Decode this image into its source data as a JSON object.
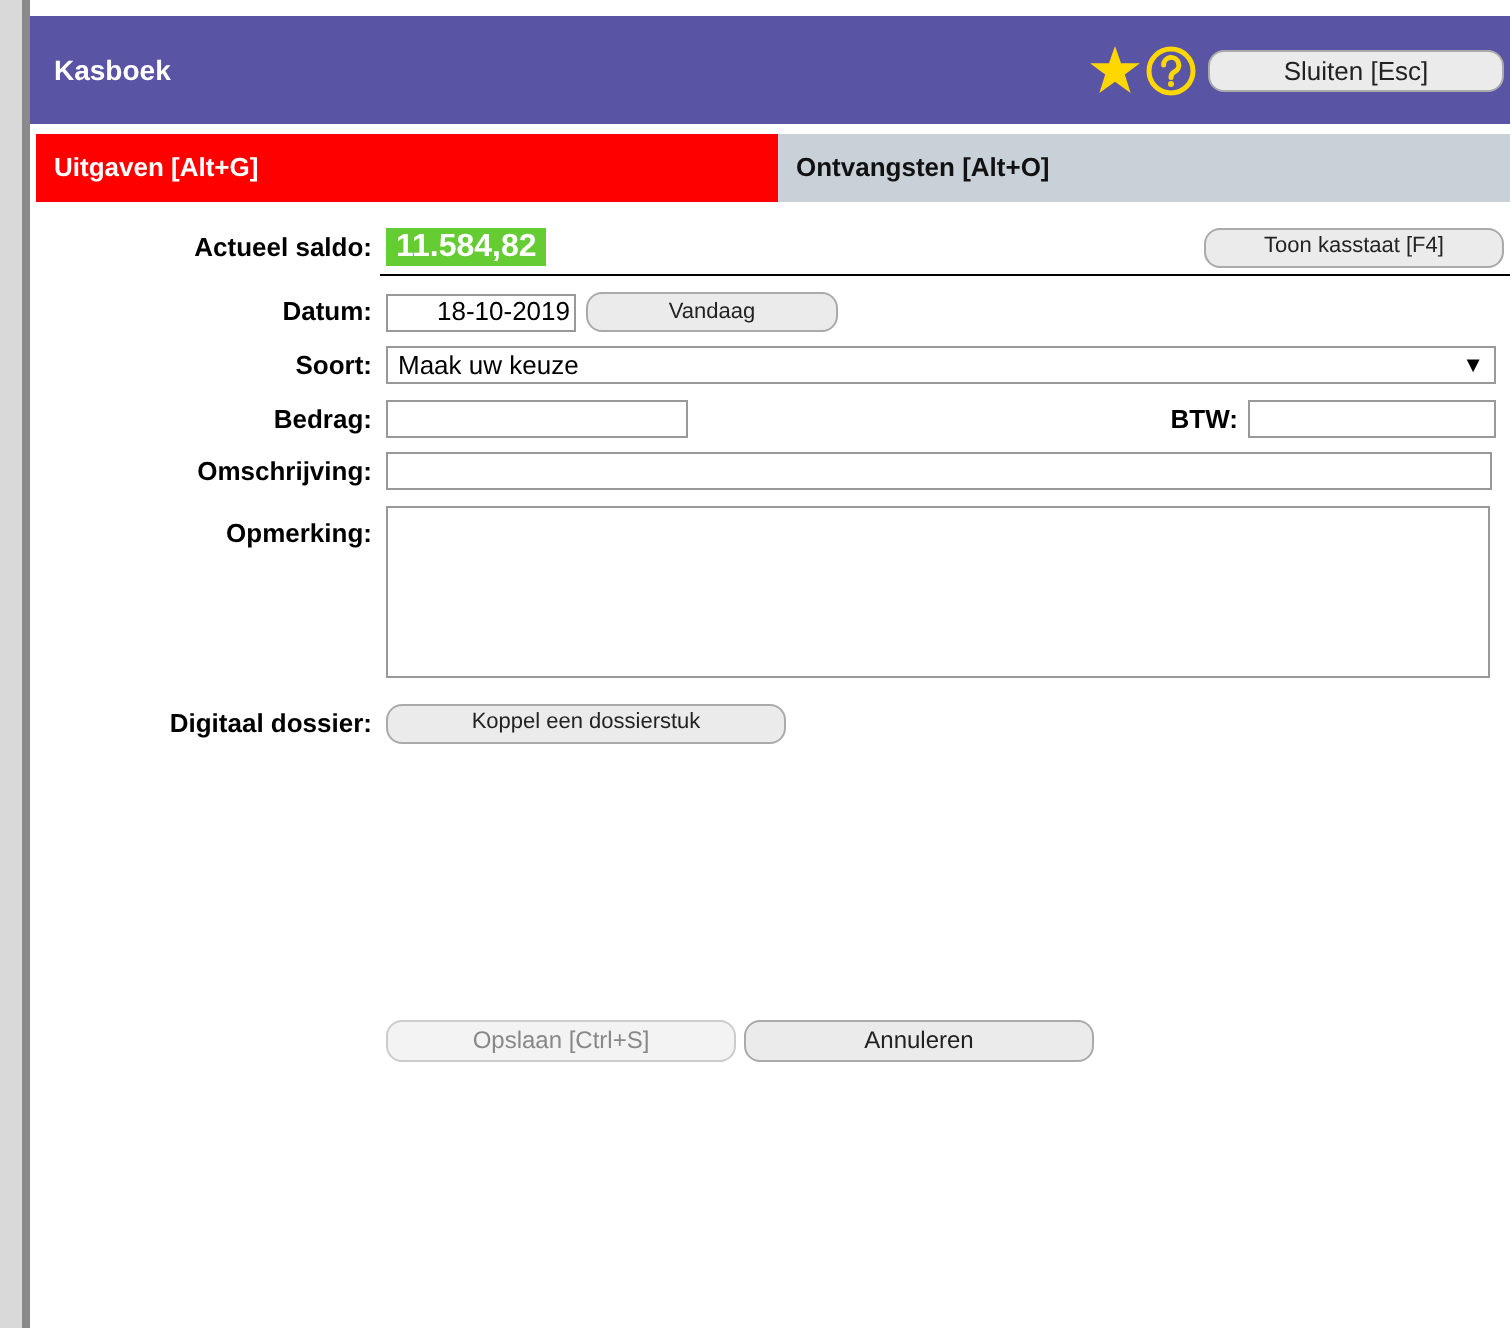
{
  "dialog": {
    "title": "Kasboek",
    "close_button": "Sluiten [Esc]"
  },
  "tabs": [
    {
      "label": "Uitgaven [Alt+G]",
      "selected": true
    },
    {
      "label": "Ontvangsten [Alt+O]",
      "selected": false
    }
  ],
  "balance": {
    "label": "Actueel saldo:",
    "value": "11.584,82",
    "button": "Toon kasstaat [F4]"
  },
  "fields": [
    {
      "kind": "date",
      "label": "Datum:",
      "value": "18-10-2019",
      "button": "Vandaag"
    },
    {
      "kind": "select",
      "label": "Soort:",
      "value": "Maak uw keuze",
      "arrow": "▼"
    },
    {
      "kind": "pair",
      "label": "Bedrag:",
      "label2": "BTW:"
    },
    {
      "kind": "text",
      "label": "Omschrijving:"
    },
    {
      "kind": "textarea",
      "label": "Opmerking:"
    },
    {
      "kind": "button",
      "label": "Digitaal dossier:",
      "button": "Koppel een dossierstuk"
    }
  ],
  "actions": [
    {
      "label": "Opslaan [Ctrl+S]",
      "disabled": true
    },
    {
      "label": "Annuleren",
      "disabled": false
    }
  ]
}
